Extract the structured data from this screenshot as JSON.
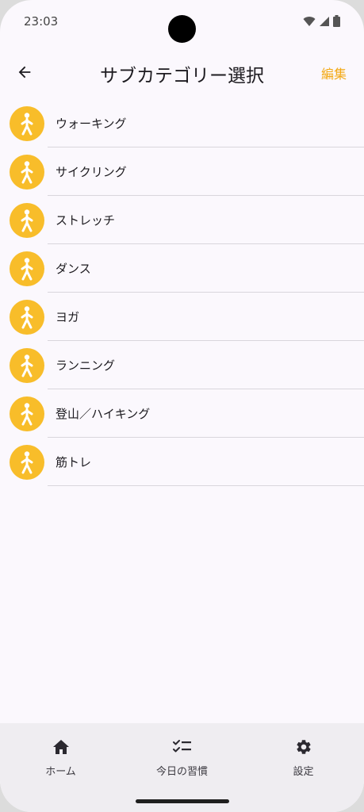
{
  "status_bar": {
    "time": "23:03"
  },
  "app_bar": {
    "title": "サブカテゴリー選択",
    "edit_label": "編集",
    "back_icon": "arrow-left-icon"
  },
  "colors": {
    "accent": "#f3a915",
    "avatar_bg": "#f8bd2a"
  },
  "subcategories": [
    {
      "label": "ウォーキング",
      "icon": "walking-person-icon"
    },
    {
      "label": "サイクリング",
      "icon": "walking-person-icon"
    },
    {
      "label": "ストレッチ",
      "icon": "walking-person-icon"
    },
    {
      "label": "ダンス",
      "icon": "walking-person-icon"
    },
    {
      "label": "ヨガ",
      "icon": "walking-person-icon"
    },
    {
      "label": "ランニング",
      "icon": "walking-person-icon"
    },
    {
      "label": "登山／ハイキング",
      "icon": "walking-person-icon"
    },
    {
      "label": "筋トレ",
      "icon": "walking-person-icon"
    }
  ],
  "bottom_nav": {
    "items": [
      {
        "label": "ホーム",
        "icon": "home-icon"
      },
      {
        "label": "今日の習慣",
        "icon": "checklist-icon"
      },
      {
        "label": "設定",
        "icon": "gear-icon"
      }
    ]
  }
}
